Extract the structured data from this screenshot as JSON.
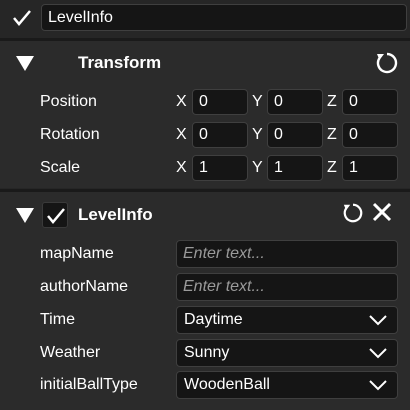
{
  "object": {
    "name": "LevelInfo",
    "enabled": true
  },
  "transform": {
    "title": "Transform",
    "rows": [
      {
        "label": "Position",
        "x": "0",
        "y": "0",
        "z": "0"
      },
      {
        "label": "Rotation",
        "x": "0",
        "y": "0",
        "z": "0"
      },
      {
        "label": "Scale",
        "x": "1",
        "y": "1",
        "z": "1"
      }
    ],
    "axis_labels": {
      "x": "X",
      "y": "Y",
      "z": "Z"
    }
  },
  "component": {
    "title": "LevelInfo",
    "enabled": true,
    "fields": {
      "mapName": {
        "label": "mapName",
        "value": "",
        "placeholder": "Enter text..."
      },
      "authorName": {
        "label": "authorName",
        "value": "",
        "placeholder": "Enter text..."
      },
      "time": {
        "label": "Time",
        "selected": "Daytime"
      },
      "weather": {
        "label": "Weather",
        "selected": "Sunny"
      },
      "initialBallType": {
        "label": "initialBallType",
        "selected": "WoodenBall"
      }
    }
  },
  "icons": {
    "check": "check-icon",
    "collapse": "triangle-down-icon",
    "reset": "reset-icon",
    "close": "close-icon",
    "dropdown": "chevron-down-icon"
  }
}
